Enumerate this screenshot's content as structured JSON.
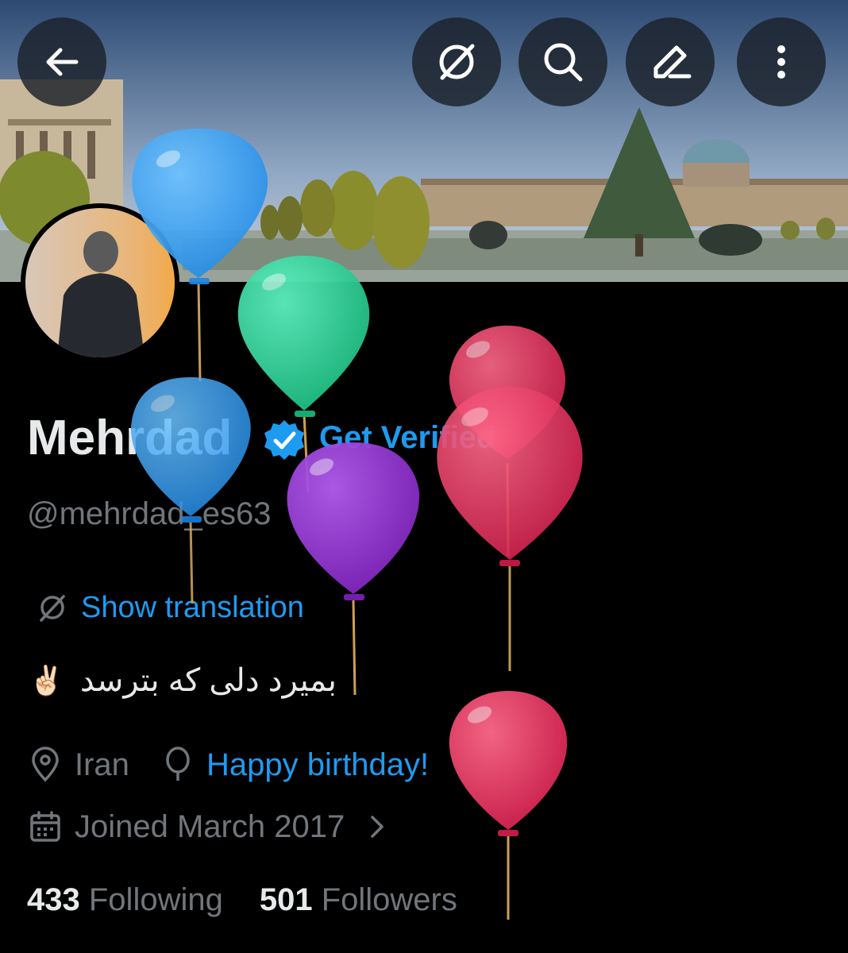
{
  "header": {
    "back_icon": "arrow-left-icon",
    "translate_icon": "translate-icon",
    "search_icon": "search-icon",
    "edit_icon": "pencil-icon",
    "more_icon": "more-vertical-icon"
  },
  "profile": {
    "name": "Mehrdad",
    "verified_badge": "verified-badge-icon",
    "get_verified": "Get Verified",
    "handle": "@mehrdad_es63",
    "show_translation": "Show translation",
    "bio_emoji": "✌🏻",
    "bio_text": "بمیرد دلی که بترسد",
    "location": "Iran",
    "birthday": "Happy birthday!",
    "joined": "Joined March 2017",
    "following_count": "433",
    "following_label": "Following",
    "followers_count": "501",
    "followers_label": "Followers"
  },
  "colors": {
    "background": "#000000",
    "accent": "#1d9bf0",
    "muted": "#71767b",
    "text": "#e7e9ea"
  }
}
